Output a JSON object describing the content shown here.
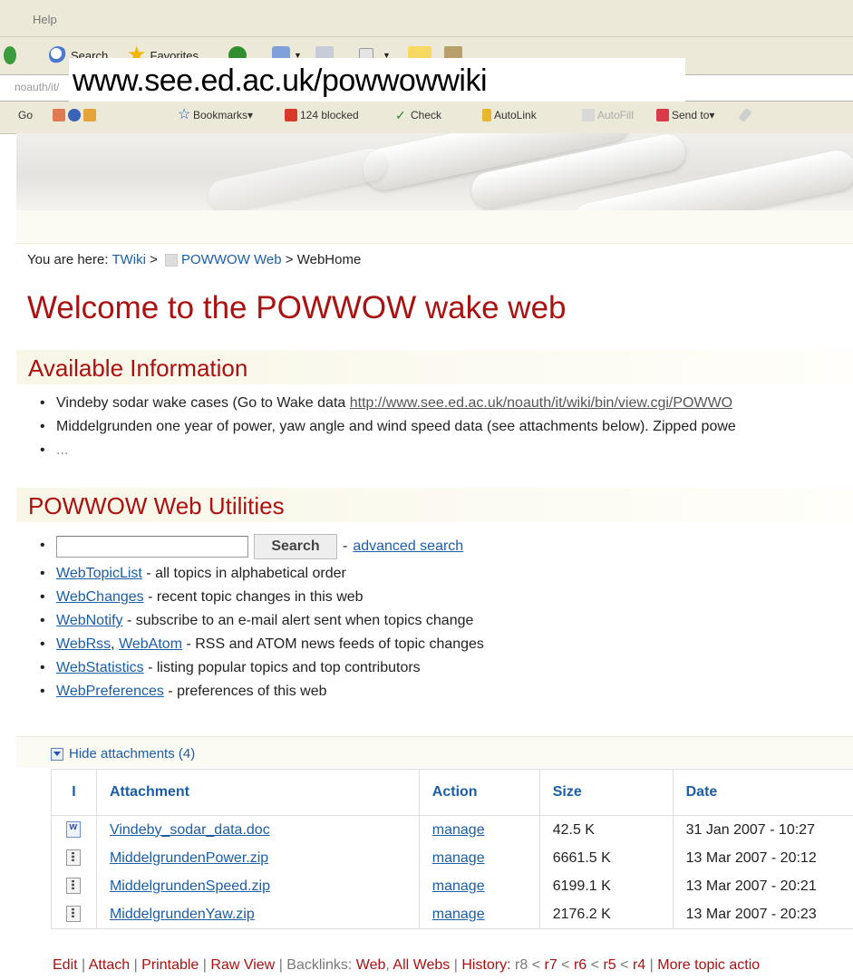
{
  "browser": {
    "menu": {
      "help": "Help"
    },
    "toolbar": {
      "search": "Search",
      "favorites": "Favorites"
    },
    "address_partial": "noauth/it/",
    "overlay_url": "www.see.ed.ac.uk/powwowwiki",
    "linkbar": {
      "go": "Go",
      "bookmarks": "Bookmarks▾",
      "blocked": "124 blocked",
      "check": "Check",
      "autolink": "AutoLink",
      "autofill": "AutoFill",
      "sendto": "Send to▾"
    }
  },
  "breadcrumb": {
    "prefix": "You are here:",
    "twiki": "TWiki",
    "sep1": ">",
    "web": "POWWOW Web",
    "sep2": "> WebHome"
  },
  "page_title": "Welcome to the POWWOW wake web",
  "available": {
    "heading": "Available Information",
    "items": [
      {
        "text": "Vindeby sodar wake cases (Go to Wake data ",
        "link": "http://www.see.ed.ac.uk/noauth/it/wiki/bin/view.cgi/POWWO"
      },
      {
        "text": "Middelgrunden one year of power, yaw angle and wind speed data (see attachments below). Zipped powe"
      },
      {
        "text": "..."
      }
    ]
  },
  "utilities": {
    "heading": "POWWOW Web Utilities",
    "search_button": "Search",
    "search_sep": "-",
    "advanced": "advanced search",
    "items": [
      {
        "link": "WebTopicList",
        "desc": " - all topics in alphabetical order"
      },
      {
        "link": "WebChanges",
        "desc": " - recent topic changes in this web"
      },
      {
        "link": "WebNotify",
        "desc": " - subscribe to an e-mail alert sent when topics change"
      },
      {
        "link": "WebRss",
        "sep": ", ",
        "link2": "WebAtom",
        "desc": " - RSS and ATOM news feeds of topic changes"
      },
      {
        "link": "WebStatistics",
        "desc": " - listing popular topics and top contributors"
      },
      {
        "link": "WebPreferences",
        "desc": " - preferences of this web"
      }
    ]
  },
  "attachments": {
    "toggle": "Hide attachments (4)",
    "headers": [
      "I",
      "Attachment",
      "Action",
      "Size",
      "Date"
    ],
    "rows": [
      {
        "icon": "doc-file-icon",
        "name": "Vindeby_sodar_data.doc",
        "action": "manage",
        "size": "42.5 K",
        "date": "31 Jan 2007 - 10:27"
      },
      {
        "icon": "zip-file-icon",
        "name": "MiddelgrundenPower.zip",
        "action": "manage",
        "size": "6661.5 K",
        "date": "13 Mar 2007 - 20:12"
      },
      {
        "icon": "zip-file-icon",
        "name": "MiddelgrundenSpeed.zip",
        "action": "manage",
        "size": "6199.1 K",
        "date": "13 Mar 2007 - 20:21"
      },
      {
        "icon": "zip-file-icon",
        "name": "MiddelgrundenYaw.zip",
        "action": "manage",
        "size": "2176.2 K",
        "date": "13 Mar 2007 - 20:23"
      }
    ]
  },
  "footer": {
    "edit": "Edit",
    "attach": "Attach",
    "printable": "Printable",
    "rawview": "Raw View",
    "backlinks": "Backlinks:",
    "web": "Web",
    "allwebs": "All Webs",
    "history": "History:",
    "r8": "r8",
    "r7": "r7",
    "r6": "r6",
    "r5": "r5",
    "r4": "r4",
    "more": "More topic actio"
  }
}
